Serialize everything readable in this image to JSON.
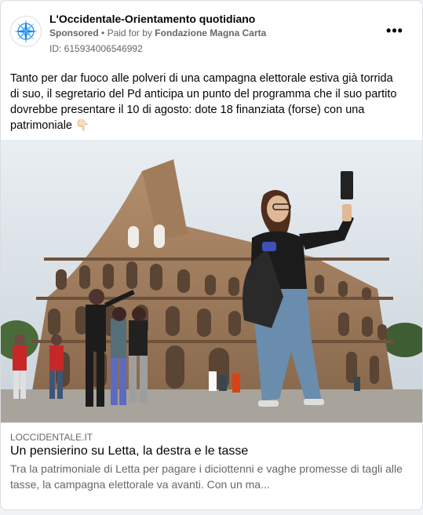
{
  "post": {
    "page_name": "L'Occidentale-Orientamento quotidiano",
    "sponsored": "Sponsored",
    "separator": "•",
    "paid_for_prefix": "Paid for by",
    "payer": "Fondazione Magna Carta",
    "ad_id": "ID: 615934006546992",
    "more_label": "•••",
    "body": "Tanto per dar fuoco alle polveri di una campagna elettorale estiva già torrida di suo, il segretario del Pd anticipa un punto del programma che il suo partito dovrebbe presentare il 10 di agosto: dote 18 finanziata (forse) con una patrimoniale 👇🏻",
    "avatar_icon": "compass-rose-logo-icon",
    "brand_color": "#1e88e5"
  },
  "link": {
    "domain": "LOCCIDENTALE.IT",
    "title": "Un pensierino su Letta, la destra e le tasse",
    "description": "Tra la patrimoniale di Letta per pagare i diciottenni e vaghe promesse di tagli alle tasse, la campagna elettorale va avanti. Con un ma..."
  },
  "image": {
    "subject": "colosseum-selfie-photo"
  }
}
